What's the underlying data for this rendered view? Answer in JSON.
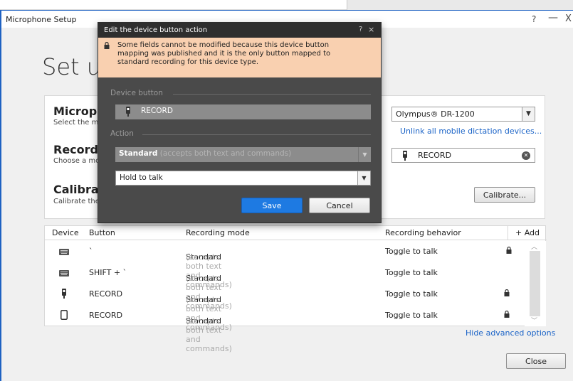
{
  "window": {
    "title": "Microphone Setup",
    "help": "?",
    "minimize": "—",
    "close": "X",
    "heading": "Set up"
  },
  "sections": {
    "microphone": {
      "title": "Microphone",
      "subtitle": "Select the microphone"
    },
    "record": {
      "title": "Record button",
      "subtitle": "Choose a mobile dictation device button"
    },
    "calibration": {
      "title": "Calibration",
      "subtitle": "Calibrate the microphone"
    }
  },
  "controls": {
    "mic_select_value": "Olympus® DR-1200",
    "unlink_link": "Unlink all mobile dictation devices...",
    "record_value": "RECORD",
    "calibrate_label": "Calibrate..."
  },
  "table": {
    "headers": {
      "device": "Device",
      "button": "Button",
      "mode": "Recording mode",
      "behavior": "Recording behavior",
      "add": "+ Add"
    },
    "rows": [
      {
        "device_icon": "keyboard-icon",
        "button": "`",
        "mode": "Standard",
        "mode_hint": "(accepts both text and commands)",
        "behavior": "Toggle to talk",
        "locked": true
      },
      {
        "device_icon": "keyboard-icon",
        "button": "SHIFT + `",
        "mode": "Standard",
        "mode_hint": "(accepts both text and commands)",
        "behavior": "Toggle to talk",
        "locked": false
      },
      {
        "device_icon": "dictation-recorder-icon",
        "button": "RECORD",
        "mode": "Standard",
        "mode_hint": "(accepts both text and commands)",
        "behavior": "Toggle to talk",
        "locked": true
      },
      {
        "device_icon": "phone-icon",
        "button": "RECORD",
        "mode": "Standard",
        "mode_hint": "(accepts both text and commands)",
        "behavior": "Toggle to talk",
        "locked": true
      }
    ]
  },
  "footer": {
    "hide_advanced": "Hide advanced options",
    "close_label": "Close"
  },
  "dialog": {
    "title": "Edit the device button action",
    "help": "?",
    "close": "×",
    "warning": "Some fields cannot be modified because this device button mapping was published and it is the only button mapped to standard recording for this device type.",
    "device_button_label": "Device button",
    "device_button_value": "RECORD",
    "action_label": "Action",
    "action_mode_value": "Standard",
    "action_mode_hint": "(accepts both text and commands)",
    "action_behavior_value": "Hold to talk",
    "save_label": "Save",
    "cancel_label": "Cancel"
  },
  "colors": {
    "accent": "#1e7ae2",
    "link": "#1a63c7",
    "warning_bg": "#f9d0b0",
    "dialog_bg": "#4a4a4a",
    "window_border": "#1f62c2"
  }
}
